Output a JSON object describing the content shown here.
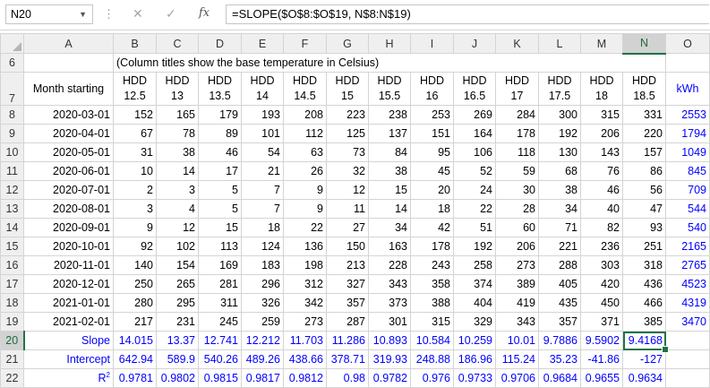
{
  "namebox": "N20",
  "formula": "=SLOPE($O$8:$O$19, N$8:N$19)",
  "fx_label": "fx",
  "columns": [
    "A",
    "B",
    "C",
    "D",
    "E",
    "F",
    "G",
    "H",
    "I",
    "J",
    "K",
    "L",
    "M",
    "N",
    "O"
  ],
  "selected_column": "N",
  "selected_row": "20",
  "note": "(Column titles show the base temperature in Celsius)",
  "header_row": {
    "row": "7",
    "month_label": "Month starting",
    "hdd_word": "HDD",
    "temps": [
      "12.5",
      "13",
      "13.5",
      "14",
      "14.5",
      "15",
      "15.5",
      "16",
      "16.5",
      "17",
      "17.5",
      "18",
      "18.5"
    ],
    "kwh_label": "kWh"
  },
  "data_rows": [
    {
      "row": "8",
      "date": "2020-03-01",
      "hdd": [
        "152",
        "165",
        "179",
        "193",
        "208",
        "223",
        "238",
        "253",
        "269",
        "284",
        "300",
        "315",
        "331"
      ],
      "kwh": "2553"
    },
    {
      "row": "9",
      "date": "2020-04-01",
      "hdd": [
        "67",
        "78",
        "89",
        "101",
        "112",
        "125",
        "137",
        "151",
        "164",
        "178",
        "192",
        "206",
        "220"
      ],
      "kwh": "1794"
    },
    {
      "row": "10",
      "date": "2020-05-01",
      "hdd": [
        "31",
        "38",
        "46",
        "54",
        "63",
        "73",
        "84",
        "95",
        "106",
        "118",
        "130",
        "143",
        "157"
      ],
      "kwh": "1049"
    },
    {
      "row": "11",
      "date": "2020-06-01",
      "hdd": [
        "10",
        "14",
        "17",
        "21",
        "26",
        "32",
        "38",
        "45",
        "52",
        "59",
        "68",
        "76",
        "86"
      ],
      "kwh": "845"
    },
    {
      "row": "12",
      "date": "2020-07-01",
      "hdd": [
        "2",
        "3",
        "5",
        "7",
        "9",
        "12",
        "15",
        "20",
        "24",
        "30",
        "38",
        "46",
        "56"
      ],
      "kwh": "709"
    },
    {
      "row": "13",
      "date": "2020-08-01",
      "hdd": [
        "3",
        "4",
        "5",
        "7",
        "9",
        "11",
        "14",
        "18",
        "22",
        "28",
        "34",
        "40",
        "47"
      ],
      "kwh": "544"
    },
    {
      "row": "14",
      "date": "2020-09-01",
      "hdd": [
        "9",
        "12",
        "15",
        "18",
        "22",
        "27",
        "34",
        "42",
        "51",
        "60",
        "71",
        "82",
        "93"
      ],
      "kwh": "540"
    },
    {
      "row": "15",
      "date": "2020-10-01",
      "hdd": [
        "92",
        "102",
        "113",
        "124",
        "136",
        "150",
        "163",
        "178",
        "192",
        "206",
        "221",
        "236",
        "251"
      ],
      "kwh": "2165"
    },
    {
      "row": "16",
      "date": "2020-11-01",
      "hdd": [
        "140",
        "154",
        "169",
        "183",
        "198",
        "213",
        "228",
        "243",
        "258",
        "273",
        "288",
        "303",
        "318"
      ],
      "kwh": "2765"
    },
    {
      "row": "17",
      "date": "2020-12-01",
      "hdd": [
        "250",
        "265",
        "281",
        "296",
        "312",
        "327",
        "343",
        "358",
        "374",
        "389",
        "405",
        "420",
        "436"
      ],
      "kwh": "4523"
    },
    {
      "row": "18",
      "date": "2021-01-01",
      "hdd": [
        "280",
        "295",
        "311",
        "326",
        "342",
        "357",
        "373",
        "388",
        "404",
        "419",
        "435",
        "450",
        "466"
      ],
      "kwh": "4319"
    },
    {
      "row": "19",
      "date": "2021-02-01",
      "hdd": [
        "217",
        "231",
        "245",
        "259",
        "273",
        "287",
        "301",
        "315",
        "329",
        "343",
        "357",
        "371",
        "385"
      ],
      "kwh": "3470"
    }
  ],
  "stat_rows": [
    {
      "row": "20",
      "label": "Slope",
      "values": [
        "14.015",
        "13.37",
        "12.741",
        "12.212",
        "11.703",
        "11.286",
        "10.893",
        "10.584",
        "10.259",
        "10.01",
        "9.7886",
        "9.5902",
        "9.4168"
      ]
    },
    {
      "row": "21",
      "label": "Intercept",
      "values": [
        "642.94",
        "589.9",
        "540.26",
        "489.26",
        "438.66",
        "378.71",
        "319.93",
        "248.88",
        "186.96",
        "115.24",
        "35.23",
        "-41.86",
        "-127"
      ]
    },
    {
      "row": "22",
      "label": "R",
      "label_sup": "2",
      "values": [
        "0.9781",
        "0.9802",
        "0.9815",
        "0.9817",
        "0.9812",
        "0.98",
        "0.9782",
        "0.976",
        "0.9733",
        "0.9706",
        "0.9684",
        "0.9655",
        "0.9634"
      ]
    }
  ],
  "colors": {
    "accent": "#217346",
    "blue": "#0000ff",
    "header_bg": "#efefef",
    "gridline": "#d4d4d4"
  }
}
